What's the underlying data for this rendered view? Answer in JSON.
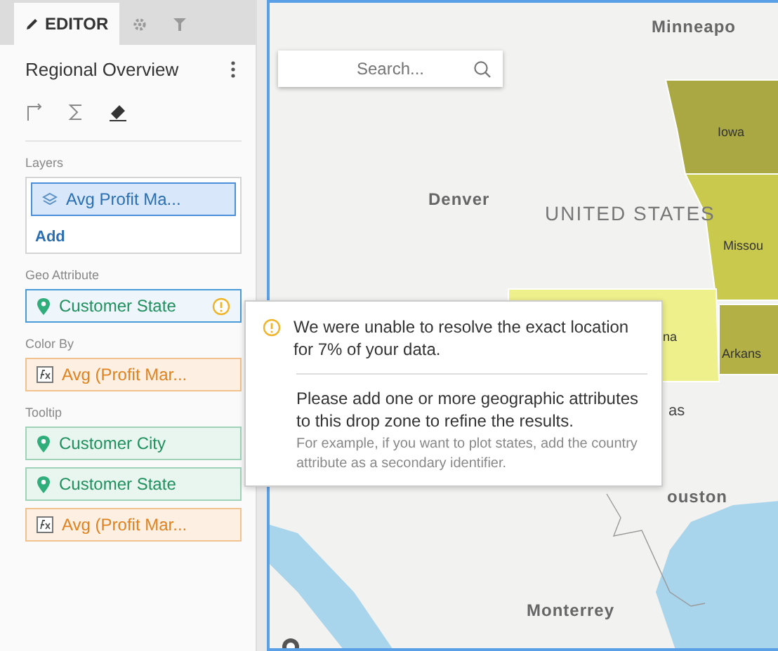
{
  "tabs": [
    {
      "kind": "editor",
      "label": "EDITOR",
      "selected": true
    },
    {
      "kind": "settings",
      "selected": false
    },
    {
      "kind": "filter",
      "selected": false
    }
  ],
  "title": "Regional Overview",
  "sections": [
    {
      "label": "Layers",
      "items": [
        {
          "kind": "layer",
          "text": "Avg Profit Ma...",
          "selected": true
        }
      ],
      "add": "Add"
    },
    {
      "label": "Geo Attribute",
      "items": [
        {
          "kind": "geo",
          "text": "Customer State",
          "selected": true,
          "warning": true
        }
      ]
    },
    {
      "label": "Color By",
      "items": [
        {
          "kind": "measure",
          "text": "Avg (Profit Mar...",
          "selected": false
        }
      ]
    },
    {
      "label": "Tooltip",
      "items": [
        {
          "kind": "geo",
          "text": "Customer City",
          "selected": false
        },
        {
          "kind": "geo",
          "text": "Customer State",
          "selected": false
        },
        {
          "kind": "measure",
          "text": "Avg (Profit Mar...",
          "selected": false
        }
      ]
    }
  ],
  "map": {
    "search": {
      "placeholder": "Search..."
    },
    "labels": [
      {
        "kind": "city",
        "text": "Minneapo"
      },
      {
        "kind": "region",
        "text": "Iowa",
        "color": "#a9a842"
      },
      {
        "kind": "city",
        "text": "Denver"
      },
      {
        "kind": "country",
        "text": "UNITED STATES"
      },
      {
        "kind": "region",
        "text": "Missou",
        "color": "#c9c94d"
      },
      {
        "kind": "region",
        "text": "na",
        "color": "#eef08c"
      },
      {
        "kind": "region",
        "text": "Arkans",
        "color": "#b3b145"
      },
      {
        "kind": "state",
        "text": "as"
      },
      {
        "kind": "city",
        "text": "ouston"
      },
      {
        "kind": "city",
        "text": "Monterrey"
      }
    ]
  },
  "popup": {
    "message": "We were unable to resolve the exact location for 7% of your data.",
    "advice": "Please add one or more geographic attributes to this drop zone to refine the results.",
    "example": "For example, if you want to plot states, add the country attribute as a secondary identifier."
  }
}
